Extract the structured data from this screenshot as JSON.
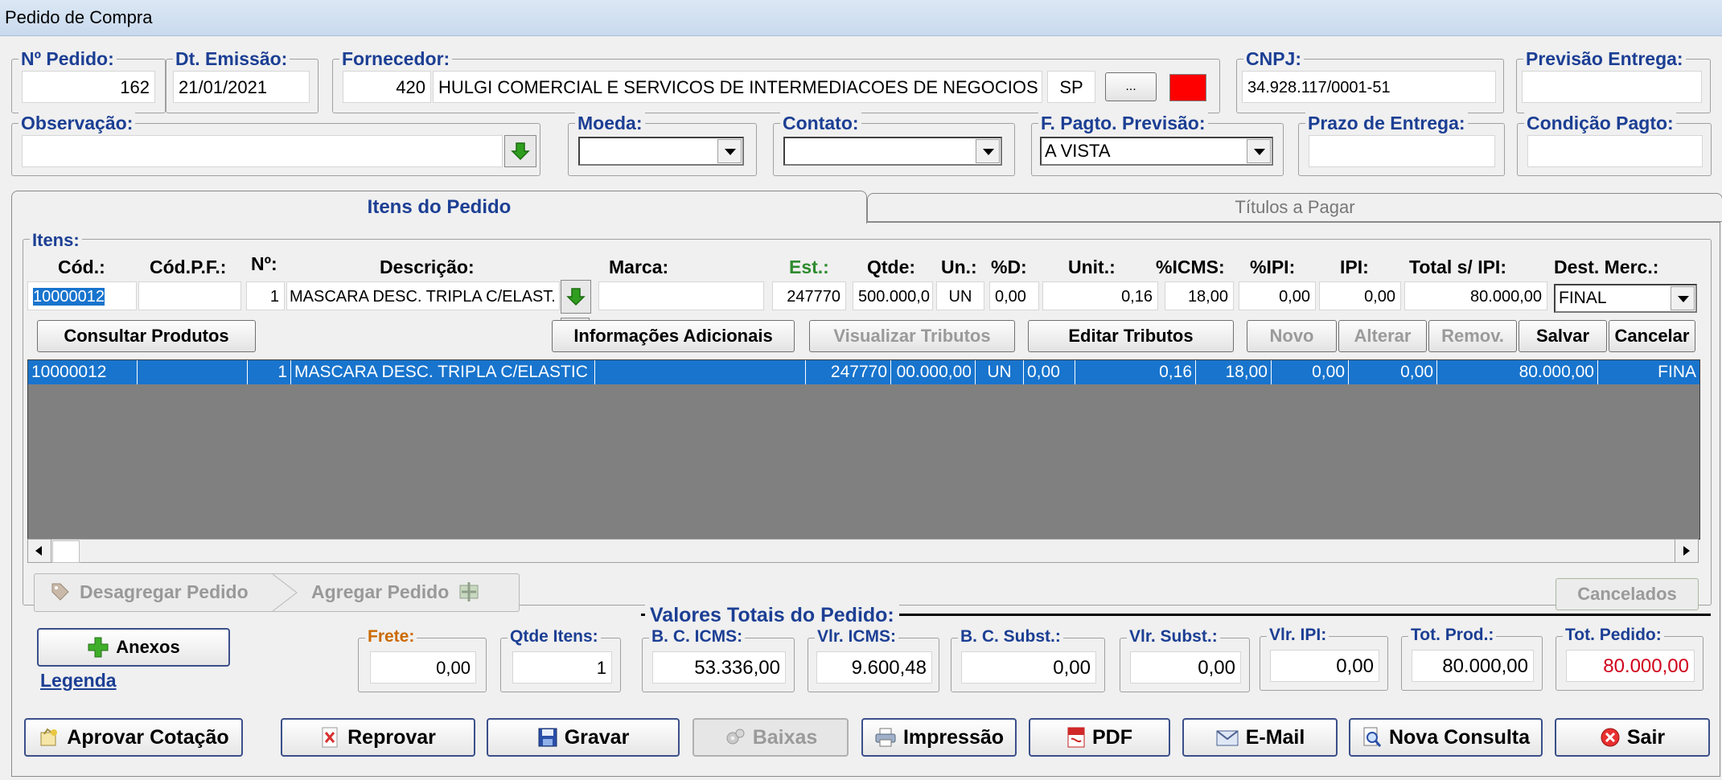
{
  "window": {
    "title": "Pedido de Compra"
  },
  "header": {
    "pedido": {
      "label": "Nº Pedido:",
      "value": "162"
    },
    "emissao": {
      "label": "Dt. Emissão:",
      "value": "21/01/2021"
    },
    "fornecedor": {
      "label": "Fornecedor:",
      "code": "420",
      "name": "HULGI COMERCIAL E SERVICOS DE INTERMEDIACOES DE NEGOCIOS",
      "uf": "SP",
      "lookup": "...",
      "color": "#ff0000"
    },
    "cnpj": {
      "label": "CNPJ:",
      "value": "34.928.117/0001-51"
    },
    "previsao": {
      "label": "Previsão Entrega:",
      "value": ""
    },
    "observacao": {
      "label": "Observação:",
      "value": ""
    },
    "moeda": {
      "label": "Moeda:",
      "value": ""
    },
    "contato": {
      "label": "Contato:",
      "value": ""
    },
    "fpagto": {
      "label": "F. Pagto. Previsão:",
      "value": "A VISTA"
    },
    "prazo": {
      "label": "Prazo de Entrega:",
      "value": ""
    },
    "condicao": {
      "label": "Condição Pagto:",
      "value": ""
    }
  },
  "tabs": [
    {
      "label": "Itens do Pedido",
      "active": true
    },
    {
      "label": "Títulos a Pagar",
      "active": false
    }
  ],
  "itens": {
    "group_label": "Itens:",
    "columns": [
      "Cód.:",
      "Cód.P.F.:",
      "Nº:",
      "Descrição:",
      "Marca:",
      "Est.:",
      "Qtde:",
      "Un.:",
      "%D:",
      "Unit.:",
      "%ICMS:",
      "%IPI:",
      "IPI:",
      "Total s/ IPI:",
      "Dest. Merc.:"
    ],
    "edit": {
      "cod": "10000012",
      "codpf": "",
      "num": "1",
      "descricao": "MASCARA DESC. TRIPLA C/ELAST.",
      "marca": "",
      "est": "247770",
      "qtde": "500.000,0",
      "un": "UN",
      "desc": "0,00",
      "unit": "0,16",
      "icms": "18,00",
      "ipi_pct": "0,00",
      "ipi": "0,00",
      "total": "80.000,00",
      "dest": "FINAL"
    },
    "buttons": {
      "consultar": "Consultar Produtos",
      "info": "Informações Adicionais",
      "visualizar": "Visualizar Tributos",
      "editar": "Editar Tributos",
      "novo": "Novo",
      "alterar": "Alterar",
      "remov": "Remov.",
      "salvar": "Salvar",
      "cancelar": "Cancelar"
    },
    "rows": [
      {
        "cod": "10000012",
        "codpf": "",
        "num": "1",
        "descricao": "MASCARA DESC. TRIPLA C/ELASTIC",
        "marca": "",
        "est": "247770",
        "qtde": "00.000,00",
        "un": "UN",
        "desc": "0,00",
        "unit": "0,16",
        "icms": "18,00",
        "ipi_pct": "0,00",
        "ipi": "0,00",
        "total": "80.000,00",
        "dest": "FINA"
      }
    ]
  },
  "actions": {
    "desagregar": "Desagregar Pedido",
    "agregar": "Agregar Pedido",
    "cancelados": "Cancelados",
    "anexos": "Anexos",
    "legenda": "Legenda"
  },
  "totais": {
    "title": "Valores Totais do Pedido:",
    "frete": {
      "label": "Frete:",
      "value": "0,00"
    },
    "qtde_itens": {
      "label": "Qtde Itens:",
      "value": "1"
    },
    "bc_icms": {
      "label": "B. C. ICMS:",
      "value": "53.336,00"
    },
    "vlr_icms": {
      "label": "Vlr. ICMS:",
      "value": "9.600,48"
    },
    "bc_subst": {
      "label": "B. C. Subst.:",
      "value": "0,00"
    },
    "vlr_subst": {
      "label": "Vlr. Subst.:",
      "value": "0,00"
    },
    "vlr_ipi": {
      "label": "Vlr. IPI:",
      "value": "0,00"
    },
    "tot_prod": {
      "label": "Tot. Prod.:",
      "value": "80.000,00"
    },
    "tot_pedido": {
      "label": "Tot. Pedido:",
      "value": "80.000,00"
    }
  },
  "footer": {
    "aprovar": "Aprovar Cotação",
    "reprovar": "Reprovar",
    "gravar": "Gravar",
    "baixas": "Baixas",
    "impressao": "Impressão",
    "pdf": "PDF",
    "email": "E-Mail",
    "nova": "Nova Consulta",
    "sair": "Sair"
  },
  "colors": {
    "label_blue": "#1c3f94",
    "est_green": "#2e8b2e",
    "selection": "#1874cd",
    "grid_bg": "#808080",
    "total_red": "#d0021b"
  }
}
